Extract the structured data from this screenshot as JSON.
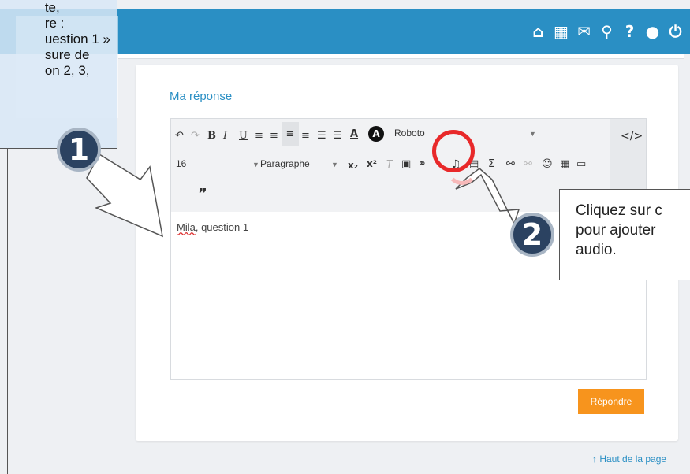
{
  "topbar": {
    "icons": [
      "home-icon",
      "apps-grid-icon",
      "mail-icon",
      "search-icon",
      "help-icon",
      "user-icon",
      "power-icon"
    ],
    "glyphs": [
      "⌂",
      "▦",
      "✉",
      "⚲",
      "?",
      "●",
      "⏻"
    ]
  },
  "card": {
    "title": "Ma réponse",
    "reply_button": "Répondre"
  },
  "editor": {
    "font_name": "Roboto",
    "font_size": "16",
    "paragraph": "Paragraphe",
    "code_view": "</>",
    "quote": "”",
    "content": "Mila, question 1",
    "content_underlined": "Mila"
  },
  "footer": {
    "top_link": "↑ Haut de la page"
  },
  "tutorial": {
    "left_text": "te,\nre :\nuestion 1 »\nsure de\non 2, 3,",
    "step1": "1",
    "step2": "2",
    "right_text": "Cliquez sur c\npour ajouter\naudio."
  },
  "colors": {
    "accent": "#2a8fc4",
    "reply": "#f7941d",
    "highlight": "#e8292a",
    "step_circle": "#2b4261"
  }
}
